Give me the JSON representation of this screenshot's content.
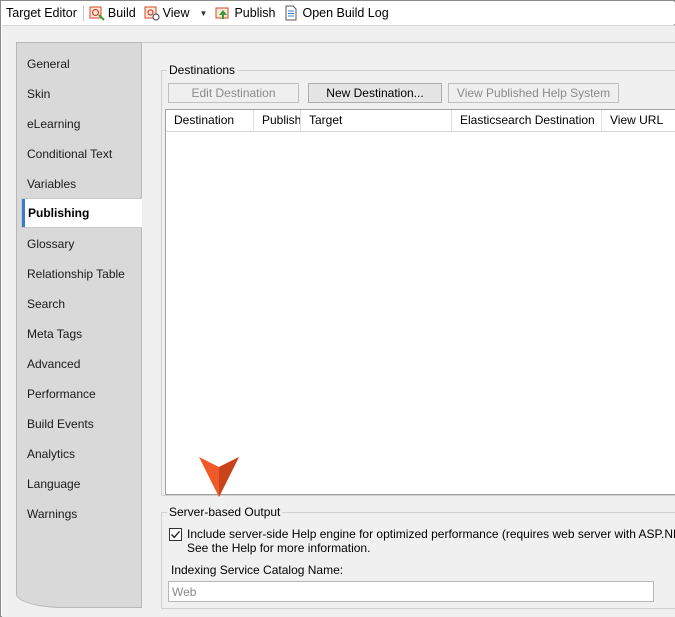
{
  "toolbar": {
    "title": "Target Editor",
    "build_label": "Build",
    "view_label": "View",
    "publish_label": "Publish",
    "open_log_label": "Open Build Log"
  },
  "sidebar": {
    "items": [
      {
        "label": "General"
      },
      {
        "label": "Skin"
      },
      {
        "label": "eLearning"
      },
      {
        "label": "Conditional Text"
      },
      {
        "label": "Variables"
      },
      {
        "label": "Publishing"
      },
      {
        "label": "Glossary"
      },
      {
        "label": "Relationship Table"
      },
      {
        "label": "Search"
      },
      {
        "label": "Meta Tags"
      },
      {
        "label": "Advanced"
      },
      {
        "label": "Performance"
      },
      {
        "label": "Build Events"
      },
      {
        "label": "Analytics"
      },
      {
        "label": "Language"
      },
      {
        "label": "Warnings"
      }
    ],
    "active": "Publishing"
  },
  "destinations": {
    "group_label": "Destinations",
    "edit_button": "Edit Destination",
    "new_button": "New Destination...",
    "view_button": "View Published Help System",
    "columns": [
      "Destination",
      "Publish",
      "Target",
      "Elasticsearch Destination",
      "View URL"
    ]
  },
  "server_output": {
    "group_label": "Server-based Output",
    "checkbox_checked": true,
    "checkbox_line1": "Include server-side Help engine for optimized performance (requires web server with ASP.NET).",
    "checkbox_line2": "See the Help for more information.",
    "index_label": "Indexing Service Catalog Name:",
    "index_value": "Web"
  },
  "colors": {
    "accent": "#3a7cc9",
    "marker": "#f05a28"
  }
}
